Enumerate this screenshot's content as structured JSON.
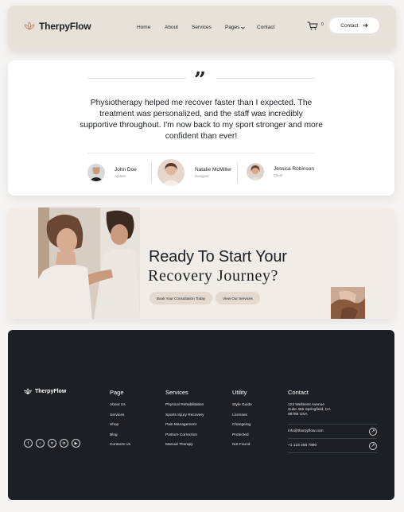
{
  "header": {
    "brand": "TherpyFlow",
    "nav": [
      "Home",
      "About",
      "Services",
      "Pages",
      "Contact"
    ],
    "cart_count": "0",
    "contact_label": "Contact"
  },
  "testimonial": {
    "quote": "Physiotherapy helped me recover faster than I expected. The treatment was personalized, and the staff was incredibly supportive throughout. I'm now back to my sport stronger and more confident than ever!",
    "people": [
      {
        "name": "John Doe",
        "role": "Athlete"
      },
      {
        "name": "Natalie McMiller",
        "role": "Designer"
      },
      {
        "name": "Jessica Robinson",
        "role": "Client"
      }
    ]
  },
  "cta": {
    "title_line1": "Ready To Start Your",
    "title_line2": "Recovery Journey?",
    "primary_button": "Book Your Consultation Today",
    "secondary_button": "View Our Services"
  },
  "footer": {
    "brand": "TherpyFlow",
    "page": {
      "heading": "Page",
      "links": [
        "About Us",
        "Services",
        "Shop",
        "Blog",
        "Contacts Us"
      ]
    },
    "services": {
      "heading": "Services",
      "links": [
        "Physical Rehabilitation",
        "Sports Injury Recovery",
        "Pain Management",
        "Posture Correction",
        "Manual Therapy"
      ]
    },
    "utility": {
      "heading": "Utility",
      "links": [
        "Style Guide",
        "Licenses",
        "Changelog",
        "Protected",
        "Not Found"
      ]
    },
    "contact": {
      "heading": "Contact",
      "address": [
        "123 Wellness Avenue",
        "Suite 456 Springfield, CA",
        "98765 USA"
      ],
      "email": "info@therpyflow.com",
      "phone": "+1 123 456 7890"
    },
    "social_icons": [
      "facebook-icon",
      "instagram-icon",
      "x-icon",
      "linkedin-icon",
      "youtube-icon"
    ]
  },
  "colors": {
    "header_bg": "#e8e1d9",
    "cta_bg": "#f1ece6",
    "footer_bg": "#1c2025",
    "button_beige": "#e3d9cf"
  }
}
